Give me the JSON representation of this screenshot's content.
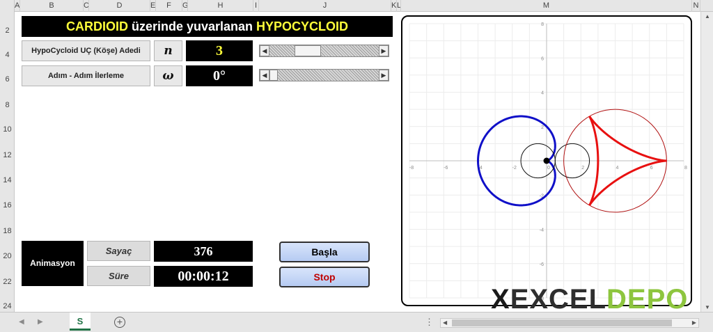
{
  "columns": [
    "A",
    "B",
    "C",
    "D",
    "E",
    "F",
    "G",
    "H",
    "I",
    "J",
    "K",
    "L",
    "M",
    "N"
  ],
  "rows": [
    "2",
    "4",
    "6",
    "8",
    "10",
    "12",
    "14",
    "16",
    "18",
    "20",
    "22",
    "24"
  ],
  "title": {
    "part1": "CARDIOID",
    "part2": " üzerinde yuvarlanan ",
    "part3": "HYPOCYCLOID"
  },
  "controls": {
    "n_label": "HypoCycloid  UÇ (Köşe) Adedi",
    "n_symbol": "n",
    "n_value": "3",
    "n_slider": 0.3,
    "w_label": "Adım - Adım  İlerleme",
    "w_symbol": "ω",
    "w_value": "0°",
    "w_slider": 0.0
  },
  "animation": {
    "label": "Animasyon",
    "counter_label": "Sayaç",
    "counter_value": "376",
    "time_label": "Süre",
    "time_value": "00:00:12",
    "start_button": "Başla",
    "stop_button": "Stop"
  },
  "chart_data": {
    "type": "scatter",
    "xlim": [
      -8,
      8
    ],
    "ylim": [
      -8,
      8
    ],
    "x_ticks": [
      -8,
      -6,
      -4,
      -2,
      0,
      2,
      4,
      6,
      8
    ],
    "y_ticks": [
      -8,
      -6,
      -4,
      -2,
      0,
      2,
      4,
      6,
      8
    ],
    "grid": true,
    "series": [
      {
        "kind": "cardioid",
        "color": "#1010c8",
        "a": 1
      },
      {
        "kind": "circle",
        "color": "#111111",
        "cx": -0.5,
        "cy": 0,
        "r": 1
      },
      {
        "kind": "circle",
        "color": "#111111",
        "cx": 1.5,
        "cy": 0,
        "r": 1
      },
      {
        "kind": "circle",
        "color": "#b01010",
        "cx": 4.0,
        "cy": 0,
        "r": 3.0
      },
      {
        "kind": "hypocycloid",
        "color": "#e81010",
        "cx": 4.0,
        "cy": 0,
        "R": 3.0,
        "n": 3
      },
      {
        "kind": "point",
        "color": "#000000",
        "x": 0,
        "y": 0
      }
    ]
  },
  "watermark": {
    "x": "X",
    "part1": "EXCEL",
    "part2": "DEPO"
  },
  "tabs": {
    "sheet": "S",
    "add": "+"
  },
  "icons": {
    "scroll_left": "triangle-left-icon",
    "scroll_right": "triangle-right-icon",
    "scroll_up": "triangle-up-icon",
    "scroll_down": "triangle-down-icon"
  }
}
